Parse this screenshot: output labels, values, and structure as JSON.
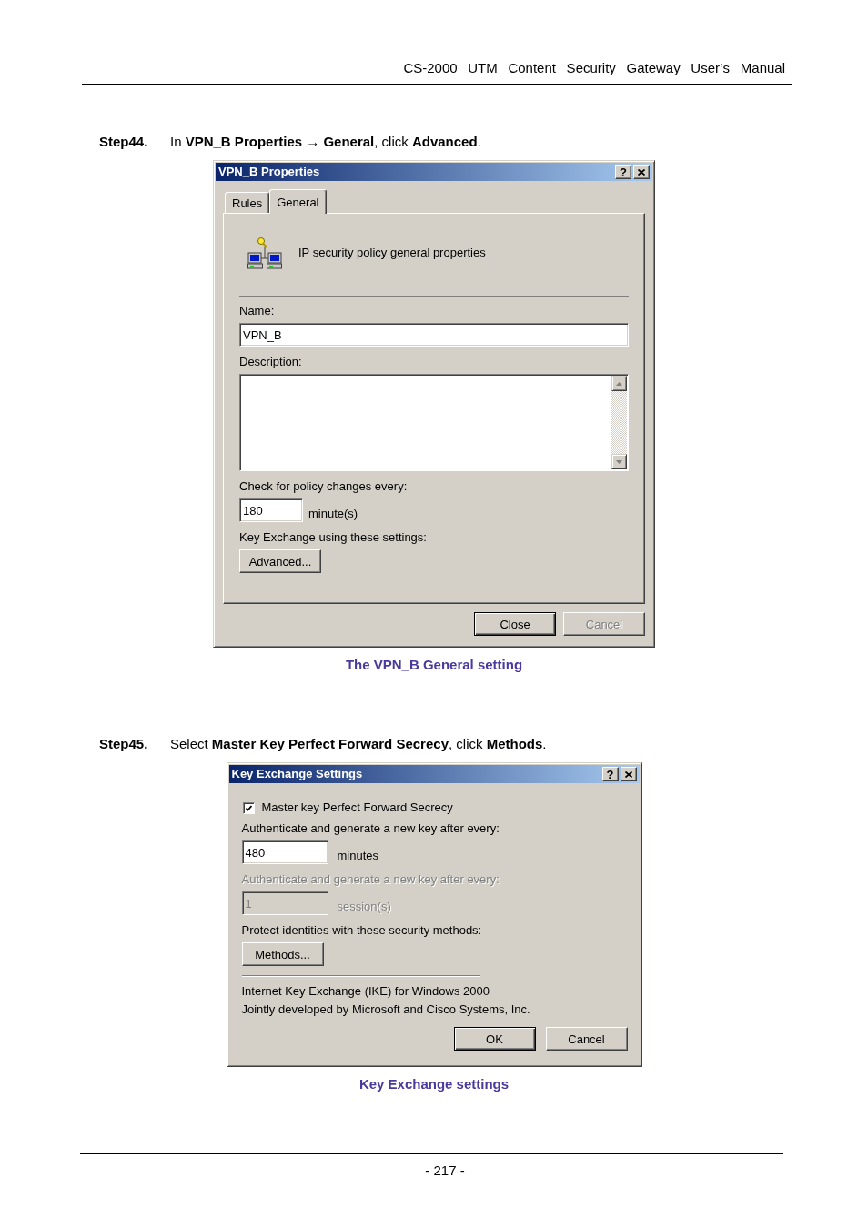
{
  "header": {
    "title": "CS-2000 UTM Content Security Gateway User’s Manual"
  },
  "steps": [
    {
      "label": "Step44.",
      "instruction": "In **VPN_B Properties → General**, click **Advanced**.",
      "dialog": {
        "kind": "property_sheet",
        "title": "VPN_B Properties",
        "title_buttons": [
          {
            "kind": "help",
            "label": "?"
          },
          {
            "kind": "close"
          }
        ],
        "tabs": [
          {
            "label": "Rules",
            "selected": false
          },
          {
            "label": "General",
            "selected": true
          }
        ],
        "items": [
          {
            "kind": "banner",
            "text": "IP security policy general properties"
          },
          {
            "kind": "rule"
          },
          {
            "kind": "label",
            "text": "Name:",
            "disabled": false
          },
          {
            "kind": "text_field",
            "value": "VPN_B",
            "disabled": false
          },
          {
            "kind": "label",
            "text": "Description:",
            "disabled": false
          },
          {
            "kind": "text_area"
          },
          {
            "kind": "label",
            "text": "Check for policy changes every:",
            "disabled": false
          },
          {
            "kind": "unit_field",
            "value": "180",
            "unit": "minute(s)",
            "disabled": false
          },
          {
            "kind": "label",
            "text": "Key Exchange using these settings:",
            "disabled": false
          },
          {
            "kind": "button",
            "label": "Advanced...",
            "disabled": false
          }
        ],
        "footer_buttons": [
          {
            "label": "Close",
            "default": true,
            "disabled": false
          },
          {
            "label": "Cancel",
            "default": false,
            "disabled": true
          }
        ]
      },
      "caption": "The VPN_B General setting"
    },
    {
      "label": "Step45.",
      "instruction": "Select **Master Key Perfect Forward Secrecy**, click **Methods**.",
      "dialog": {
        "kind": "dialog",
        "title": "Key Exchange Settings",
        "title_buttons": [
          {
            "kind": "help",
            "label": "?"
          },
          {
            "kind": "close"
          }
        ],
        "items": [
          {
            "kind": "checkbox",
            "label": "Master key Perfect Forward Secrecy",
            "checked": true
          },
          {
            "kind": "label",
            "text": "Authenticate and generate a new key after every:",
            "disabled": false
          },
          {
            "kind": "unit_field",
            "value": "480",
            "unit": "minutes",
            "disabled": false
          },
          {
            "kind": "label",
            "text": "Authenticate and generate a new key after every:",
            "disabled": true
          },
          {
            "kind": "unit_field",
            "value": "1",
            "unit": "session(s)",
            "disabled": true
          },
          {
            "kind": "label",
            "text": "Protect identities with these security methods:",
            "disabled": false
          },
          {
            "kind": "button",
            "label": "Methods...",
            "disabled": false
          },
          {
            "kind": "short_rule"
          },
          {
            "kind": "text",
            "text": "Internet Key Exchange (IKE) for Windows 2000"
          },
          {
            "kind": "text",
            "text": "Jointly developed by Microsoft and Cisco Systems, Inc."
          }
        ],
        "footer_buttons": [
          {
            "label": "OK",
            "default": true,
            "disabled": false
          },
          {
            "label": "Cancel",
            "default": false,
            "disabled": false
          }
        ]
      },
      "caption": "Key Exchange settings"
    }
  ],
  "footer": {
    "page": "- 217 -"
  }
}
